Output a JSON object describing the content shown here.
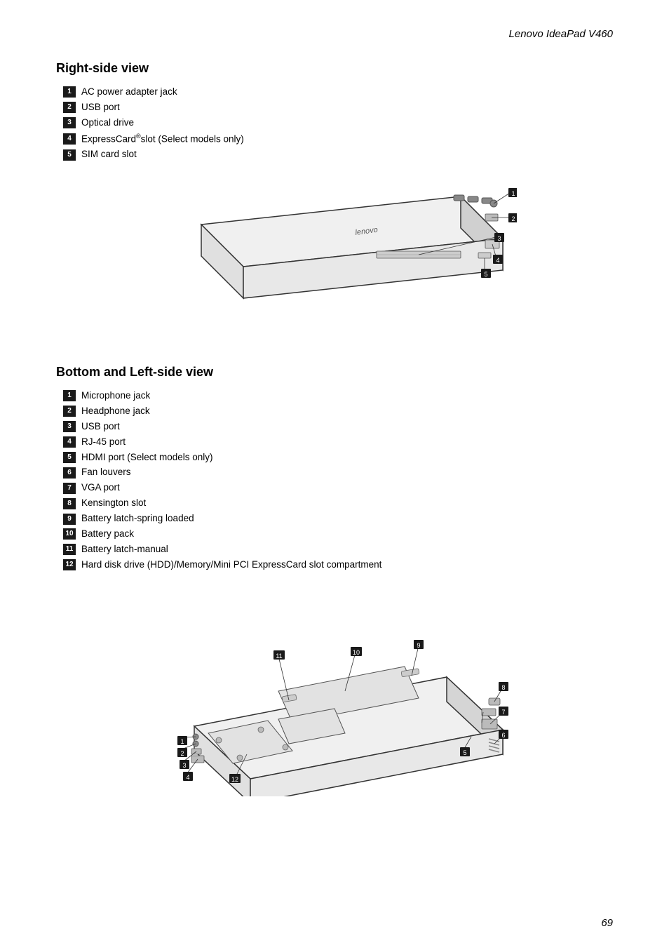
{
  "header": {
    "title": "Lenovo IdeaPad V460"
  },
  "right_side": {
    "section_title": "Right-side view",
    "items": [
      {
        "num": "1",
        "text": "AC power adapter jack"
      },
      {
        "num": "2",
        "text": "USB port"
      },
      {
        "num": "3",
        "text": "Optical drive"
      },
      {
        "num": "4",
        "text": "ExpressCard®slot (Select models only)"
      },
      {
        "num": "5",
        "text": "SIM card slot"
      }
    ]
  },
  "bottom_left": {
    "section_title": "Bottom and Left-side view",
    "items": [
      {
        "num": "1",
        "text": "Microphone jack"
      },
      {
        "num": "2",
        "text": "Headphone jack"
      },
      {
        "num": "3",
        "text": "USB port"
      },
      {
        "num": "4",
        "text": "RJ-45 port"
      },
      {
        "num": "5",
        "text": "HDMI port (Select models only)"
      },
      {
        "num": "6",
        "text": "Fan louvers"
      },
      {
        "num": "7",
        "text": "VGA port"
      },
      {
        "num": "8",
        "text": "Kensington slot"
      },
      {
        "num": "9",
        "text": "Battery latch-spring loaded"
      },
      {
        "num": "10",
        "text": "Battery pack"
      },
      {
        "num": "11",
        "text": "Battery latch-manual"
      },
      {
        "num": "12",
        "text": "Hard disk drive (HDD)/Memory/Mini PCI ExpressCard slot compartment"
      }
    ]
  },
  "page_number": "69"
}
